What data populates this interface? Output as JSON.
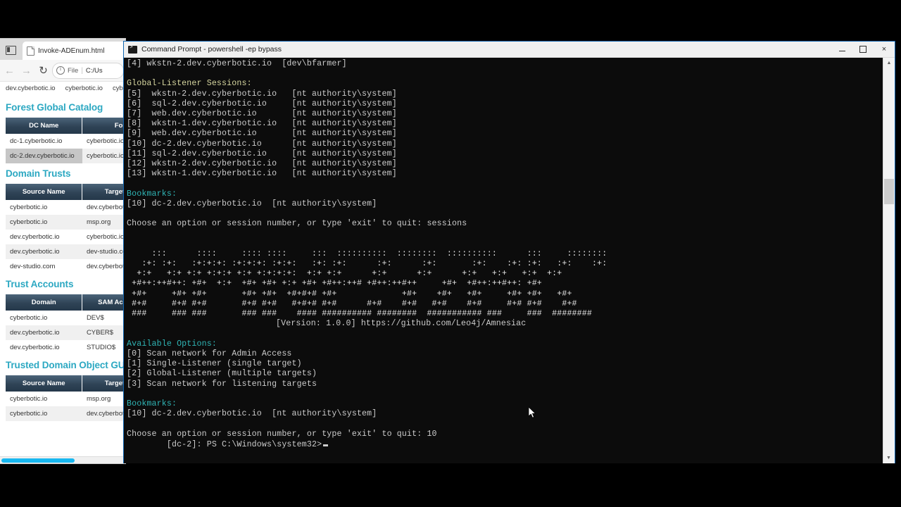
{
  "browser": {
    "tab_title": "Invoke-ADEnum.html",
    "back_icon": "arrow-left-icon",
    "forward_icon": "arrow-right-icon",
    "reload_icon": "reload-icon",
    "omnibox_scheme": "File",
    "omnibox_separator": "|",
    "omnibox_url": "C:/Us",
    "page_top_line": [
      "dev.cyberbotic.io",
      "cyberbotic.io",
      "cyb"
    ],
    "accent_heading_color": "#2ca8c2",
    "sections": [
      {
        "title": "Forest Global Catalog",
        "columns": [
          "DC Name",
          "Forest"
        ],
        "rows": [
          [
            "dc-1.cyberbotic.io",
            "cyberbotic.io"
          ],
          [
            "dc-2.dev.cyberbotic.io",
            "cyberbotic.io"
          ]
        ],
        "highlight_cell": [
          1,
          0
        ]
      },
      {
        "title": "Domain Trusts",
        "columns": [
          "Source Name",
          "Target Name"
        ],
        "rows": [
          [
            "cyberbotic.io",
            "dev.cyberbotic.io"
          ],
          [
            "cyberbotic.io",
            "msp.org"
          ],
          [
            "dev.cyberbotic.io",
            "cyberbotic.io"
          ],
          [
            "dev.cyberbotic.io",
            "dev-studio.com"
          ],
          [
            "dev-studio.com",
            "dev.cyberbotic.io"
          ]
        ]
      },
      {
        "title": "Trust Accounts",
        "columns": [
          "Domain",
          "SAM Account Na"
        ],
        "rows": [
          [
            "cyberbotic.io",
            "DEV$"
          ],
          [
            "dev.cyberbotic.io",
            "CYBER$"
          ],
          [
            "dev.cyberbotic.io",
            "STUDIO$"
          ]
        ]
      },
      {
        "title": "Trusted Domain Object GUI",
        "columns": [
          "Source Name",
          "Target Name"
        ],
        "rows": [
          [
            "cyberbotic.io",
            "msp.org"
          ],
          [
            "cyberbotic.io",
            "dev.cyberbotic.io"
          ]
        ]
      }
    ]
  },
  "console": {
    "title": "Command Prompt - powershell  -ep bypass",
    "icon": "command-prompt-icon",
    "minimize_label": "minimize",
    "maximize_label": "maximize",
    "close_label": "×",
    "scroll_up_arrow": "▲",
    "scroll_down_arrow": "▼",
    "lines": [
      {
        "text": "[4] wkstn-2.dev.cyberbotic.io  [dev\\bfarmer]",
        "style": "white"
      },
      {
        "text": "",
        "style": "white"
      },
      {
        "text": "Global-Listener Sessions:",
        "style": "head"
      },
      {
        "text": "[5]  wkstn-2.dev.cyberbotic.io   [nt authority\\system]",
        "style": "white"
      },
      {
        "text": "[6]  sql-2.dev.cyberbotic.io     [nt authority\\system]",
        "style": "white"
      },
      {
        "text": "[7]  web.dev.cyberbotic.io       [nt authority\\system]",
        "style": "white"
      },
      {
        "text": "[8]  wkstn-1.dev.cyberbotic.io   [nt authority\\system]",
        "style": "white"
      },
      {
        "text": "[9]  web.dev.cyberbotic.io       [nt authority\\system]",
        "style": "white"
      },
      {
        "text": "[10] dc-2.dev.cyberbotic.io      [nt authority\\system]",
        "style": "white"
      },
      {
        "text": "[11] sql-2.dev.cyberbotic.io     [nt authority\\system]",
        "style": "white"
      },
      {
        "text": "[12] wkstn-2.dev.cyberbotic.io   [nt authority\\system]",
        "style": "white"
      },
      {
        "text": "[13] wkstn-1.dev.cyberbotic.io   [nt authority\\system]",
        "style": "white"
      },
      {
        "text": "",
        "style": "white"
      },
      {
        "text": "Bookmarks:",
        "style": "cyan"
      },
      {
        "text": "[10] dc-2.dev.cyberbotic.io  [nt authority\\system]",
        "style": "white"
      },
      {
        "text": "",
        "style": "white"
      },
      {
        "text": "Choose an option or session number, or type 'exit' to quit: sessions",
        "style": "white"
      }
    ],
    "banner_art": [
      "     :::      ::::     :::: ::::     :::  ::::::::::  ::::::::  ::::::::::      :::     ::::::::",
      "   :+: :+:   :+:+:+: :+:+:+: :+:+:   :+: :+:      :+:      :+:       :+:    :+: :+:   :+:    :+:",
      "  +:+   +:+ +:+ +:+:+ +:+ +:+:+:+:  +:+ +:+      +:+      +:+      +:+   +:+   +:+  +:+",
      " +#++:++#++: +#+  +:+  +#+ +#+ +:+ +#+ +#++:++# +#++:++#++     +#+  +#++:++#++: +#+",
      " +#+     +#+ +#+       +#+ +#+  +#+#+# +#+             +#+    +#+   +#+     +#+ +#+   +#+",
      " #+#     #+# #+#       #+# #+#   #+#+# #+#      #+#    #+#   #+#    #+#     #+# #+#    #+#",
      " ###     ### ###       ### ###    #### ########## ########  ########### ###     ###  ########"
    ],
    "version_line": "[Version: 1.0.0] https://github.com/Leo4j/Amnesiac",
    "options_header": "Available Options:",
    "options": [
      "[0] Scan network for Admin Access",
      "[1] Single-Listener (single target)",
      "[2] Global-Listener (multiple targets)",
      "[3] Scan network for listening targets"
    ],
    "bookmarks_header": "Bookmarks:",
    "bookmarks": [
      "[10] dc-2.dev.cyberbotic.io  [nt authority\\system]"
    ],
    "choose_prompt": "Choose an option or session number, or type 'exit' to quit: 10",
    "prompt_line": "[dc-2]: PS C:\\Windows\\system32>",
    "colors": {
      "background": "#0c0c0c",
      "foreground": "#cccccc",
      "heading_yellow": "#d7d7a0",
      "heading_cyan": "#2fb5b5",
      "border_blue": "#0e64b0"
    }
  }
}
